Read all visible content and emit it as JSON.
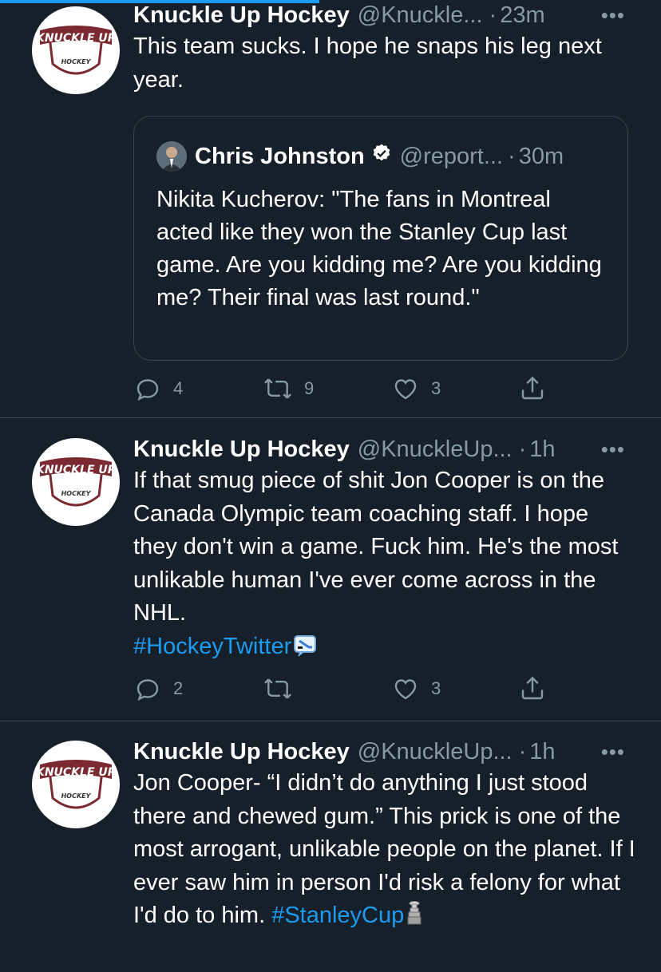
{
  "accent_color": "#1d9bf0",
  "background_color": "#15202b",
  "tweets": [
    {
      "name": "Knuckle Up Hockey",
      "handle": "@Knuckle...",
      "dot": "·",
      "time": "23m",
      "more": "•••",
      "text": "This team sucks. I hope he snaps his leg next year.",
      "avatar_logo_text": "KNUCKLE UP",
      "avatar_sub_text": "HOCKEY",
      "quote": {
        "name": "Chris Johnston",
        "handle": "@report...",
        "dot": "·",
        "time": "30m",
        "text": "Nikita Kucherov: \"The fans in Montreal acted like they won the Stanley Cup last game. Are you kidding me? Are you kidding me? Their final was last round.\""
      },
      "replies": "4",
      "retweets": "9",
      "likes": "3"
    },
    {
      "name": "Knuckle Up Hockey",
      "handle": "@KnuckleUp...",
      "dot": "·",
      "time": "1h",
      "more": "•••",
      "text": "If that smug piece of shit Jon Cooper is on the Canada Olympic team coaching staff. I hope they don't win a game. Fuck him. He's the most unlikable human I've ever come across in the NHL.",
      "hashtag": "#HockeyTwitter",
      "hashtag_icon": "hockey-emoji-icon",
      "avatar_logo_text": "KNUCKLE UP",
      "avatar_sub_text": "HOCKEY",
      "replies": "2",
      "retweets": "",
      "likes": "3"
    },
    {
      "name": "Knuckle Up Hockey",
      "handle": "@KnuckleUp...",
      "dot": "·",
      "time": "1h",
      "more": "•••",
      "text": "Jon Cooper- “I didn’t do anything I just stood there and chewed gum.” This prick is one of the most arrogant, unlikable people on the planet. If I ever saw him in person I'd risk a felony for what I'd do to him.",
      "hashtag": "#StanleyCup",
      "hashtag_icon": "stanley-cup-emoji-icon",
      "avatar_logo_text": "KNUCKLE UP",
      "avatar_sub_text": "HOCKEY"
    }
  ]
}
